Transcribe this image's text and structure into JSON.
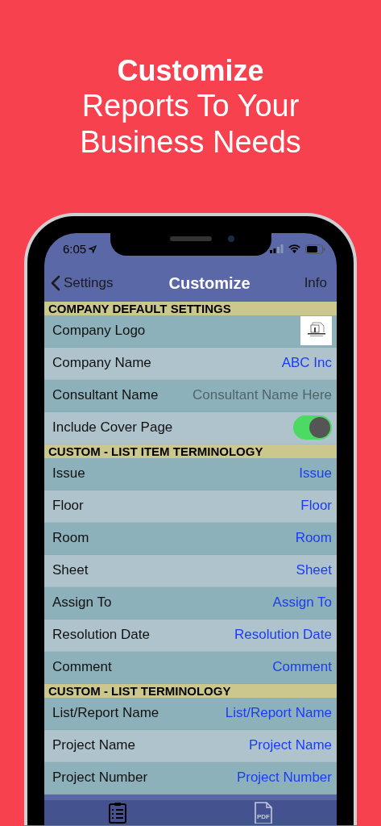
{
  "headline": {
    "title": "Customize",
    "subtitle_lines": [
      "Reports To Your",
      "Business Needs"
    ]
  },
  "status_bar": {
    "time": "6:05"
  },
  "nav": {
    "back": "Settings",
    "title": "Customize",
    "action": "Info"
  },
  "sections": [
    {
      "header": "COMPANY DEFAULT SETTINGS",
      "rows": [
        {
          "kind": "logo",
          "label": "Company Logo"
        },
        {
          "kind": "text",
          "label": "Company Name",
          "value": "ABC Inc"
        },
        {
          "kind": "field",
          "label": "Consultant Name",
          "placeholder": "Consultant Name Here"
        },
        {
          "kind": "toggle",
          "label": "Include Cover Page",
          "on": true
        }
      ]
    },
    {
      "header": "CUSTOM - LIST ITEM TERMINOLOGY",
      "rows": [
        {
          "kind": "text",
          "label": "Issue",
          "value": "Issue"
        },
        {
          "kind": "text",
          "label": "Floor",
          "value": "Floor"
        },
        {
          "kind": "text",
          "label": "Room",
          "value": "Room"
        },
        {
          "kind": "text",
          "label": "Sheet",
          "value": "Sheet"
        },
        {
          "kind": "text",
          "label": "Assign To",
          "value": "Assign To"
        },
        {
          "kind": "text",
          "label": "Resolution Date",
          "value": "Resolution Date"
        },
        {
          "kind": "text",
          "label": "Comment",
          "value": "Comment"
        }
      ]
    },
    {
      "header": "CUSTOM - LIST TERMINOLOGY",
      "rows": [
        {
          "kind": "text",
          "label": "List/Report Name",
          "value": "List/Report Name"
        },
        {
          "kind": "text",
          "label": "Project Name",
          "value": "Project Name"
        },
        {
          "kind": "text",
          "label": "Project Number",
          "value": "Project Number"
        }
      ]
    }
  ],
  "tab_bar": [
    {
      "kind": "checklist",
      "selected": true
    },
    {
      "kind": "pdf",
      "text": "PDF",
      "selected": false
    }
  ]
}
